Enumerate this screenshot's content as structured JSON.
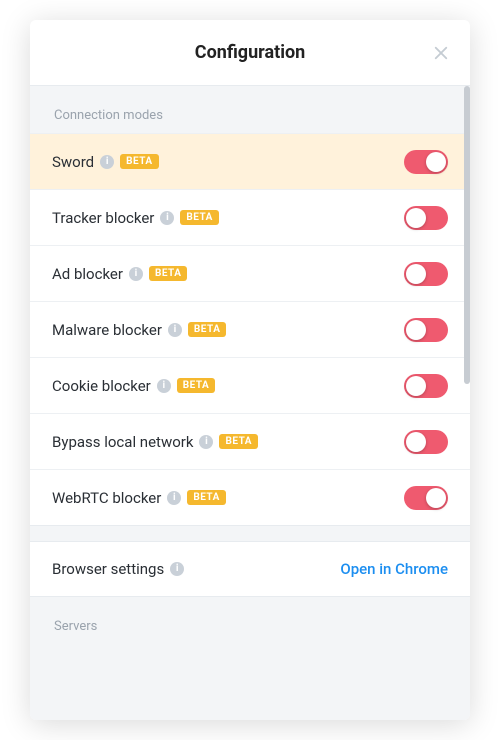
{
  "header": {
    "title": "Configuration"
  },
  "sections": {
    "connection_modes_label": "Connection modes",
    "servers_label": "Servers"
  },
  "rows": {
    "sword": {
      "label": "Sword",
      "badge": "BETA",
      "toggle_on": true,
      "highlight": true
    },
    "tracker": {
      "label": "Tracker blocker",
      "badge": "BETA",
      "toggle_on": false
    },
    "ad": {
      "label": "Ad blocker",
      "badge": "BETA",
      "toggle_on": false
    },
    "malware": {
      "label": "Malware blocker",
      "badge": "BETA",
      "toggle_on": false
    },
    "cookie": {
      "label": "Cookie blocker",
      "badge": "BETA",
      "toggle_on": false
    },
    "bypass": {
      "label": "Bypass local network",
      "badge": "BETA",
      "toggle_on": false
    },
    "webrtc": {
      "label": "WebRTC blocker",
      "badge": "BETA",
      "toggle_on": true
    },
    "browser": {
      "label": "Browser settings",
      "action": "Open in Chrome"
    }
  },
  "info_glyph": "i"
}
